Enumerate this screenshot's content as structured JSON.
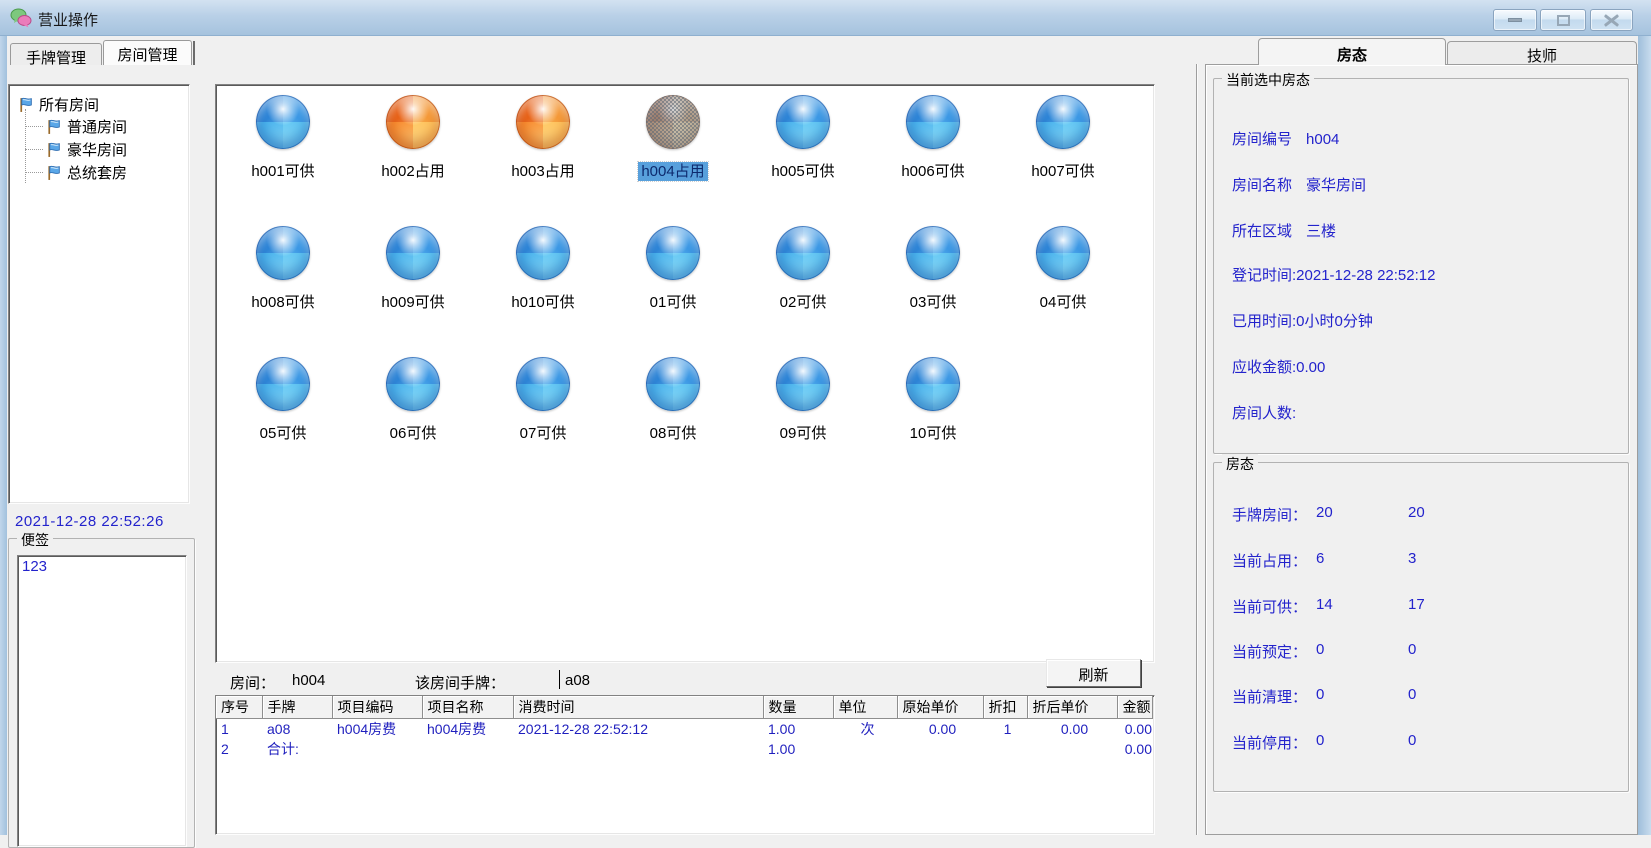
{
  "window": {
    "title": "营业操作",
    "controls": [
      "minimize",
      "maximize",
      "close"
    ]
  },
  "main_tabs": [
    {
      "label": "手牌管理",
      "active": false
    },
    {
      "label": "房间管理",
      "active": true
    }
  ],
  "sidebar": {
    "tree": {
      "root": "所有房间",
      "children": [
        "普通房间",
        "豪华房间",
        "总统套房"
      ]
    },
    "clock": "2021-12-28 22:52:26",
    "note": {
      "title": "便签",
      "content": "123"
    }
  },
  "rooms": {
    "items": [
      {
        "label": "h001可供",
        "state": "available",
        "selected": false
      },
      {
        "label": "h002占用",
        "state": "occupied",
        "selected": false
      },
      {
        "label": "h003占用",
        "state": "occupied",
        "selected": false
      },
      {
        "label": "h004占用",
        "state": "occupied",
        "selected": true
      },
      {
        "label": "h005可供",
        "state": "available",
        "selected": false
      },
      {
        "label": "h006可供",
        "state": "available",
        "selected": false
      },
      {
        "label": "h007可供",
        "state": "available",
        "selected": false
      },
      {
        "label": "h008可供",
        "state": "available",
        "selected": false
      },
      {
        "label": "h009可供",
        "state": "available",
        "selected": false
      },
      {
        "label": "h010可供",
        "state": "available",
        "selected": false
      },
      {
        "label": "01可供",
        "state": "available",
        "selected": false
      },
      {
        "label": "02可供",
        "state": "available",
        "selected": false
      },
      {
        "label": "03可供",
        "state": "available",
        "selected": false
      },
      {
        "label": "04可供",
        "state": "available",
        "selected": false
      },
      {
        "label": "05可供",
        "state": "available",
        "selected": false
      },
      {
        "label": "06可供",
        "state": "available",
        "selected": false
      },
      {
        "label": "07可供",
        "state": "available",
        "selected": false
      },
      {
        "label": "08可供",
        "state": "available",
        "selected": false
      },
      {
        "label": "09可供",
        "state": "available",
        "selected": false
      },
      {
        "label": "10可供",
        "state": "available",
        "selected": false
      }
    ]
  },
  "status_bar": {
    "room_label": "房间：",
    "room_value": "h004",
    "tag_label": "该房间手牌：",
    "tag_value": "a08",
    "refresh_button": "刷新"
  },
  "consumption_table": {
    "headers": [
      "序号",
      "手牌",
      "项目编码",
      "项目名称",
      "消费时间",
      "数量",
      "单位",
      "原始单价",
      "折扣",
      "折后单价",
      "金额"
    ],
    "rows": [
      [
        "1",
        "a08",
        "h004房费",
        "h004房费",
        "2021-12-28 22:52:12",
        "1.00",
        "次",
        "0.00",
        "1",
        "0.00",
        "0.00"
      ],
      [
        "2",
        "合计:",
        "",
        "",
        "",
        "1.00",
        "",
        "",
        "",
        "",
        "0.00"
      ]
    ]
  },
  "right_panel": {
    "tabs": [
      {
        "label": "房态",
        "active": true
      },
      {
        "label": "技师",
        "active": false
      }
    ],
    "selected_room_group": {
      "title": "当前选中房态",
      "rows": [
        {
          "label": "房间编号",
          "value": "h004"
        },
        {
          "label": "房间名称",
          "value": "豪华房间"
        },
        {
          "label": "所在区域",
          "value": "三楼"
        },
        {
          "label": "登记时间:",
          "value": "2021-12-28 22:52:12"
        },
        {
          "label": "已用时间:",
          "value": "0小时0分钟"
        },
        {
          "label": "应收金额:",
          "value": "0.00"
        },
        {
          "label": "房间人数:",
          "value": ""
        }
      ]
    },
    "room_status_group": {
      "title": "房态",
      "rows": [
        {
          "label": "手牌房间：",
          "col1": "20",
          "col2": "20"
        },
        {
          "label": "当前占用：",
          "col1": "6",
          "col2": "3"
        },
        {
          "label": "当前可供：",
          "col1": "14",
          "col2": "17"
        },
        {
          "label": "当前预定：",
          "col1": "0",
          "col2": "0"
        },
        {
          "label": "当前清理：",
          "col1": "0",
          "col2": "0"
        },
        {
          "label": "当前停用：",
          "col1": "0",
          "col2": "0"
        }
      ]
    }
  },
  "colors": {
    "blue_text": "#2323cc",
    "selection_bg": "#58a0dc",
    "room_available": "#2e86d8",
    "room_occupied": "#e8641a",
    "titlebar": "#b9d0e7"
  }
}
